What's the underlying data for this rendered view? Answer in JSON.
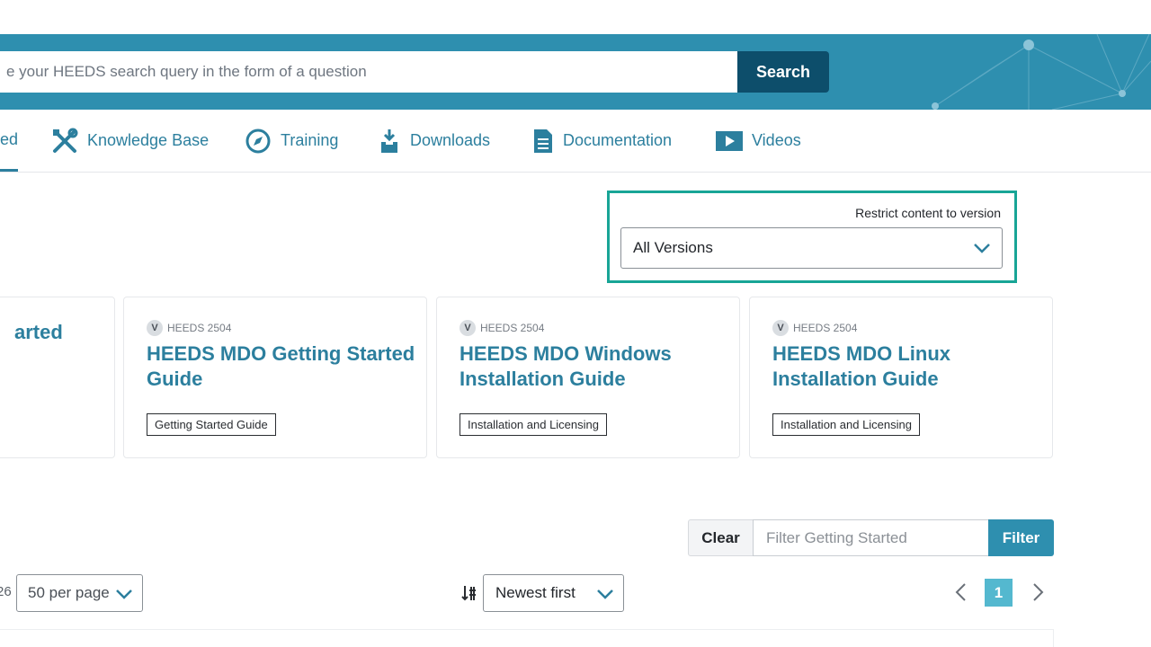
{
  "search": {
    "placeholder": "e your HEEDS search query in the form of a question",
    "button_label": "Search"
  },
  "nav": {
    "items": [
      {
        "label": "ed",
        "icon": "active-tab-partial"
      },
      {
        "label": "Knowledge Base",
        "icon": "tools-icon"
      },
      {
        "label": "Training",
        "icon": "compass-icon"
      },
      {
        "label": "Downloads",
        "icon": "download-tray-icon"
      },
      {
        "label": "Documentation",
        "icon": "document-icon"
      },
      {
        "label": "Videos",
        "icon": "play-icon"
      }
    ]
  },
  "version_filter": {
    "label": "Restrict content to version",
    "selected": "All Versions"
  },
  "cards": [
    {
      "version": "",
      "title": "arted",
      "tag": ""
    },
    {
      "version": "HEEDS 2504",
      "title": "HEEDS MDO Getting Started Guide",
      "tag": "Getting Started Guide"
    },
    {
      "version": "HEEDS 2504",
      "title": "HEEDS MDO Windows Installation Guide",
      "tag": "Installation and Licensing"
    },
    {
      "version": "HEEDS 2504",
      "title": "HEEDS MDO Linux Installation Guide",
      "tag": "Installation and Licensing"
    }
  ],
  "version_badge": "V",
  "filter": {
    "clear_label": "Clear",
    "placeholder": "Filter Getting Started",
    "button_label": "Filter"
  },
  "results": {
    "count_text": "26",
    "per_page": "50 per page",
    "sort": "Newest first",
    "current_page": "1"
  },
  "colors": {
    "banner": "#2e8faf",
    "search_button": "#0d4e6b",
    "link": "#2c7f9e",
    "highlight_border": "#18a596",
    "page_active": "#54b8cf"
  }
}
